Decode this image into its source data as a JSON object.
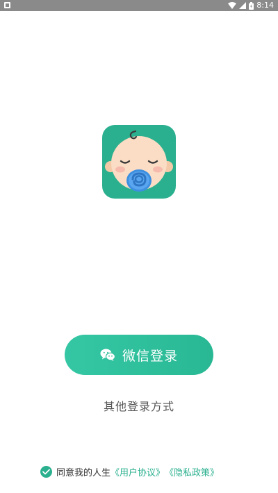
{
  "status_bar": {
    "time": "8:14",
    "icons": [
      "app-notification-icon",
      "wifi-icon",
      "signal-icon",
      "battery-icon"
    ]
  },
  "app": {
    "logo_icon": "baby-with-pacifier-logo",
    "brand_color": "#2bb08f"
  },
  "login": {
    "wechat_label": "微信登录",
    "wechat_icon": "wechat-icon",
    "other_login_label": "其他登录方式"
  },
  "agreement": {
    "checked": true,
    "prefix": "同意我的人生",
    "user_agreement": "《用户协议》",
    "privacy_policy": "《隐私政策》"
  }
}
